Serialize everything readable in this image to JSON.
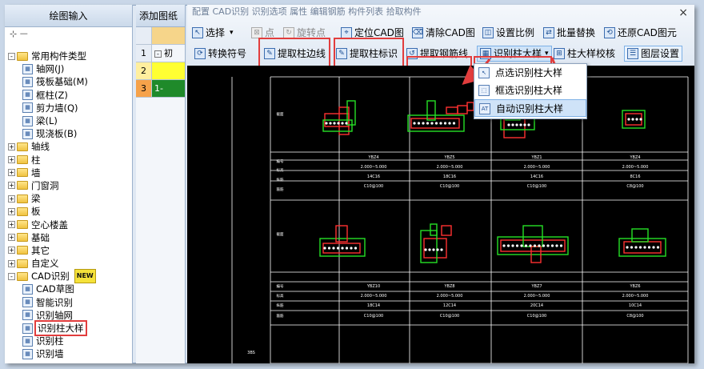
{
  "left_panel": {
    "title": "绘图输入",
    "tree": [
      {
        "label": "常用构件类型",
        "level": 0,
        "kind": "folder",
        "expanded": true
      },
      {
        "label": "轴网(J)",
        "level": 1,
        "kind": "icon",
        "icon": "grid-icon"
      },
      {
        "label": "筏板基础(M)",
        "level": 1,
        "kind": "icon",
        "icon": "raft-icon"
      },
      {
        "label": "框柱(Z)",
        "level": 1,
        "kind": "icon",
        "icon": "column-icon"
      },
      {
        "label": "剪力墙(Q)",
        "level": 1,
        "kind": "icon",
        "icon": "wall-icon"
      },
      {
        "label": "梁(L)",
        "level": 1,
        "kind": "icon",
        "icon": "beam-icon"
      },
      {
        "label": "现浇板(B)",
        "level": 1,
        "kind": "icon",
        "icon": "slab-icon"
      },
      {
        "label": "轴线",
        "level": 0,
        "kind": "folder"
      },
      {
        "label": "柱",
        "level": 0,
        "kind": "folder"
      },
      {
        "label": "墙",
        "level": 0,
        "kind": "folder"
      },
      {
        "label": "门窗洞",
        "level": 0,
        "kind": "folder"
      },
      {
        "label": "梁",
        "level": 0,
        "kind": "folder"
      },
      {
        "label": "板",
        "level": 0,
        "kind": "folder"
      },
      {
        "label": "空心楼盖",
        "level": 0,
        "kind": "folder"
      },
      {
        "label": "基础",
        "level": 0,
        "kind": "folder"
      },
      {
        "label": "其它",
        "level": 0,
        "kind": "folder"
      },
      {
        "label": "自定义",
        "level": 0,
        "kind": "folder"
      },
      {
        "label": "CAD识别",
        "level": 0,
        "kind": "folder",
        "expanded": true,
        "badge": "NEW"
      },
      {
        "label": "CAD草图",
        "level": 1,
        "kind": "icon",
        "icon": "cad-icon"
      },
      {
        "label": "智能识别",
        "level": 1,
        "kind": "icon",
        "icon": "smart-icon"
      },
      {
        "label": "识别轴网",
        "level": 1,
        "kind": "icon",
        "icon": "grid-recognize-icon"
      },
      {
        "label": "识别柱大样",
        "level": 1,
        "kind": "icon",
        "icon": "cad-icon",
        "selected": true
      },
      {
        "label": "识别柱",
        "level": 1,
        "kind": "icon",
        "icon": "column-recognize-icon"
      },
      {
        "label": "识别墙",
        "level": 1,
        "kind": "icon",
        "icon": "wall-recognize-icon"
      }
    ]
  },
  "middle_panel": {
    "title": "添加图纸",
    "rows": [
      {
        "num": "1",
        "label": "初"
      },
      {
        "num": "2",
        "label": ""
      },
      {
        "num": "3",
        "label": "1-"
      }
    ]
  },
  "toolbar": {
    "row0_faded": "配置  CAD识别  识别选项  属性  编辑钢筋  构件列表  拾取构件",
    "close": "×",
    "row1": [
      {
        "label": "选择",
        "icon": "cursor-icon"
      },
      {
        "label": "点",
        "icon": "point-icon",
        "disabled": true
      },
      {
        "label": "旋转点",
        "icon": "rotate-icon",
        "disabled": true
      },
      {
        "label": "定位CAD图",
        "icon": "locate-icon"
      },
      {
        "label": "清除CAD图",
        "icon": "clear-icon"
      },
      {
        "label": "设置比例",
        "icon": "scale-icon"
      },
      {
        "label": "批量替换",
        "icon": "replace-icon"
      },
      {
        "label": "还原CAD图元",
        "icon": "restore-icon"
      }
    ],
    "row2": [
      {
        "label": "转换符号",
        "icon": "convert-icon"
      },
      {
        "label": "提取柱边线",
        "icon": "extract-edge-icon"
      },
      {
        "label": "提取柱标识",
        "icon": "extract-label-icon"
      },
      {
        "label": "提取钢筋线",
        "icon": "extract-rebar-icon"
      },
      {
        "label": "识别柱大样",
        "icon": "recognize-icon"
      },
      {
        "label": "柱大样校核",
        "icon": "check-icon"
      },
      {
        "label": "图层设置",
        "icon": "layer-icon"
      }
    ]
  },
  "dropdown": {
    "items": [
      {
        "label": "点选识别柱大样",
        "icon": "point-select-icon"
      },
      {
        "label": "框选识别柱大样",
        "icon": "box-select-icon"
      },
      {
        "label": "自动识别柱大样",
        "icon": "auto-icon",
        "highlighted": true
      }
    ]
  },
  "drawing": {
    "row_labels": [
      "截面",
      "编号",
      "标高",
      "纵筋",
      "箍筋"
    ],
    "block1": [
      {
        "id": "YBZ4",
        "elev": "2.000~5.000",
        "rebar": "14C16",
        "stirrup": "C10@100"
      },
      {
        "id": "YBZ5",
        "elev": "2.000~5.000",
        "rebar": "18C16",
        "stirrup": "C10@100"
      },
      {
        "id": "YBZ1",
        "elev": "2.000~5.000",
        "rebar": "14C16",
        "stirrup": "C10@100"
      },
      {
        "id": "YBZ4",
        "elev": "2.000~5.000",
        "rebar": "8C16",
        "stirrup": "C8@100"
      }
    ],
    "block2": [
      {
        "id": "YBZ10",
        "elev": "2.000~5.000",
        "rebar": "18C14",
        "stirrup": "C10@100"
      },
      {
        "id": "YBZ8",
        "elev": "2.000~5.000",
        "rebar": "12C14",
        "stirrup": "C10@100"
      },
      {
        "id": "YBZ7",
        "elev": "2.000~5.000",
        "rebar": "20C14",
        "stirrup": "C10@100"
      },
      {
        "id": "YBZ6",
        "elev": "2.000~5.000",
        "rebar": "10C14",
        "stirrup": "C8@100"
      }
    ],
    "bottom_fragment": "3BS"
  },
  "colors": {
    "highlight_red": "#e23d3d",
    "cad_background": "#000000",
    "cad_green": "#26e026",
    "cad_red": "#ff3030",
    "cad_white": "#ffffff"
  }
}
